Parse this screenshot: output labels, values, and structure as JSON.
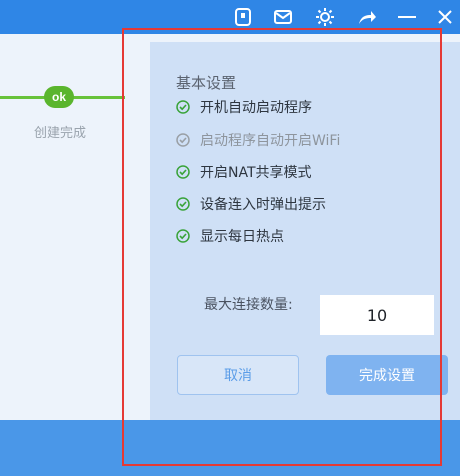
{
  "titlebar": {
    "icons": [
      "device-icon",
      "mail-icon",
      "gear-icon",
      "share-icon",
      "minimize-icon",
      "close-icon"
    ]
  },
  "progress": {
    "badge": "ok",
    "step_label": "创建完成"
  },
  "settings": {
    "title": "基本设置",
    "options": [
      {
        "label": "开机自动启动程序",
        "checked": true,
        "enabled": true
      },
      {
        "label": "启动程序自动开启WiFi",
        "checked": true,
        "enabled": false
      },
      {
        "label": "开启NAT共享模式",
        "checked": true,
        "enabled": true
      },
      {
        "label": "设备连入时弹出提示",
        "checked": true,
        "enabled": true
      },
      {
        "label": "显示每日热点",
        "checked": true,
        "enabled": true
      }
    ],
    "max_connections_label": "最大连接数量:",
    "max_connections_value": "10",
    "cancel_label": "取消",
    "done_label": "完成设置"
  },
  "colors": {
    "accent": "#2f86e6",
    "success": "#5ab52d",
    "highlight": "#e53935"
  }
}
